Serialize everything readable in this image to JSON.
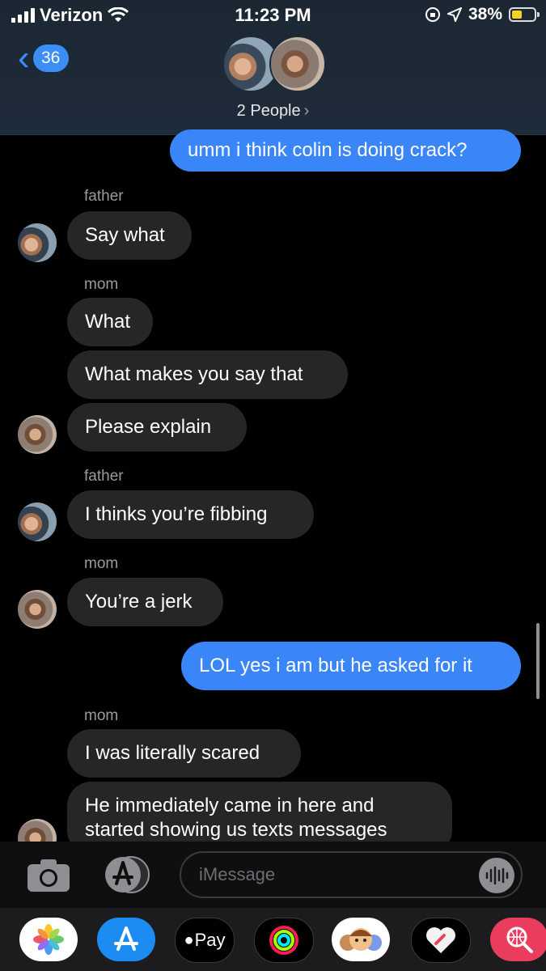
{
  "status_bar": {
    "carrier": "Verizon",
    "time": "11:23 PM",
    "battery": "38%"
  },
  "header": {
    "back_count": "36",
    "group_label": "2 People",
    "chevron": "›"
  },
  "messages": {
    "m1": "umm i think colin is doing crack?",
    "s1": "father",
    "m2": "Say what",
    "s2": "mom",
    "m3": "What",
    "m4": "What makes you say that",
    "m5": "Please explain",
    "s3": "father",
    "m6": "I thinks you’re fibbing",
    "s4": "mom",
    "m7": "You’re a jerk",
    "m8": "LOL yes i am but he asked for it",
    "s5": "mom",
    "m9": "I was literally scared",
    "m10a": "He immediately came in here and",
    "m10b": "started showing us texts messages"
  },
  "composer": {
    "placeholder": "iMessage"
  },
  "dock": {
    "apple_pay_label": "Pay"
  },
  "colors": {
    "outgoing": "#3a85f7",
    "incoming": "#262629",
    "accent": "#3a8ef6"
  }
}
